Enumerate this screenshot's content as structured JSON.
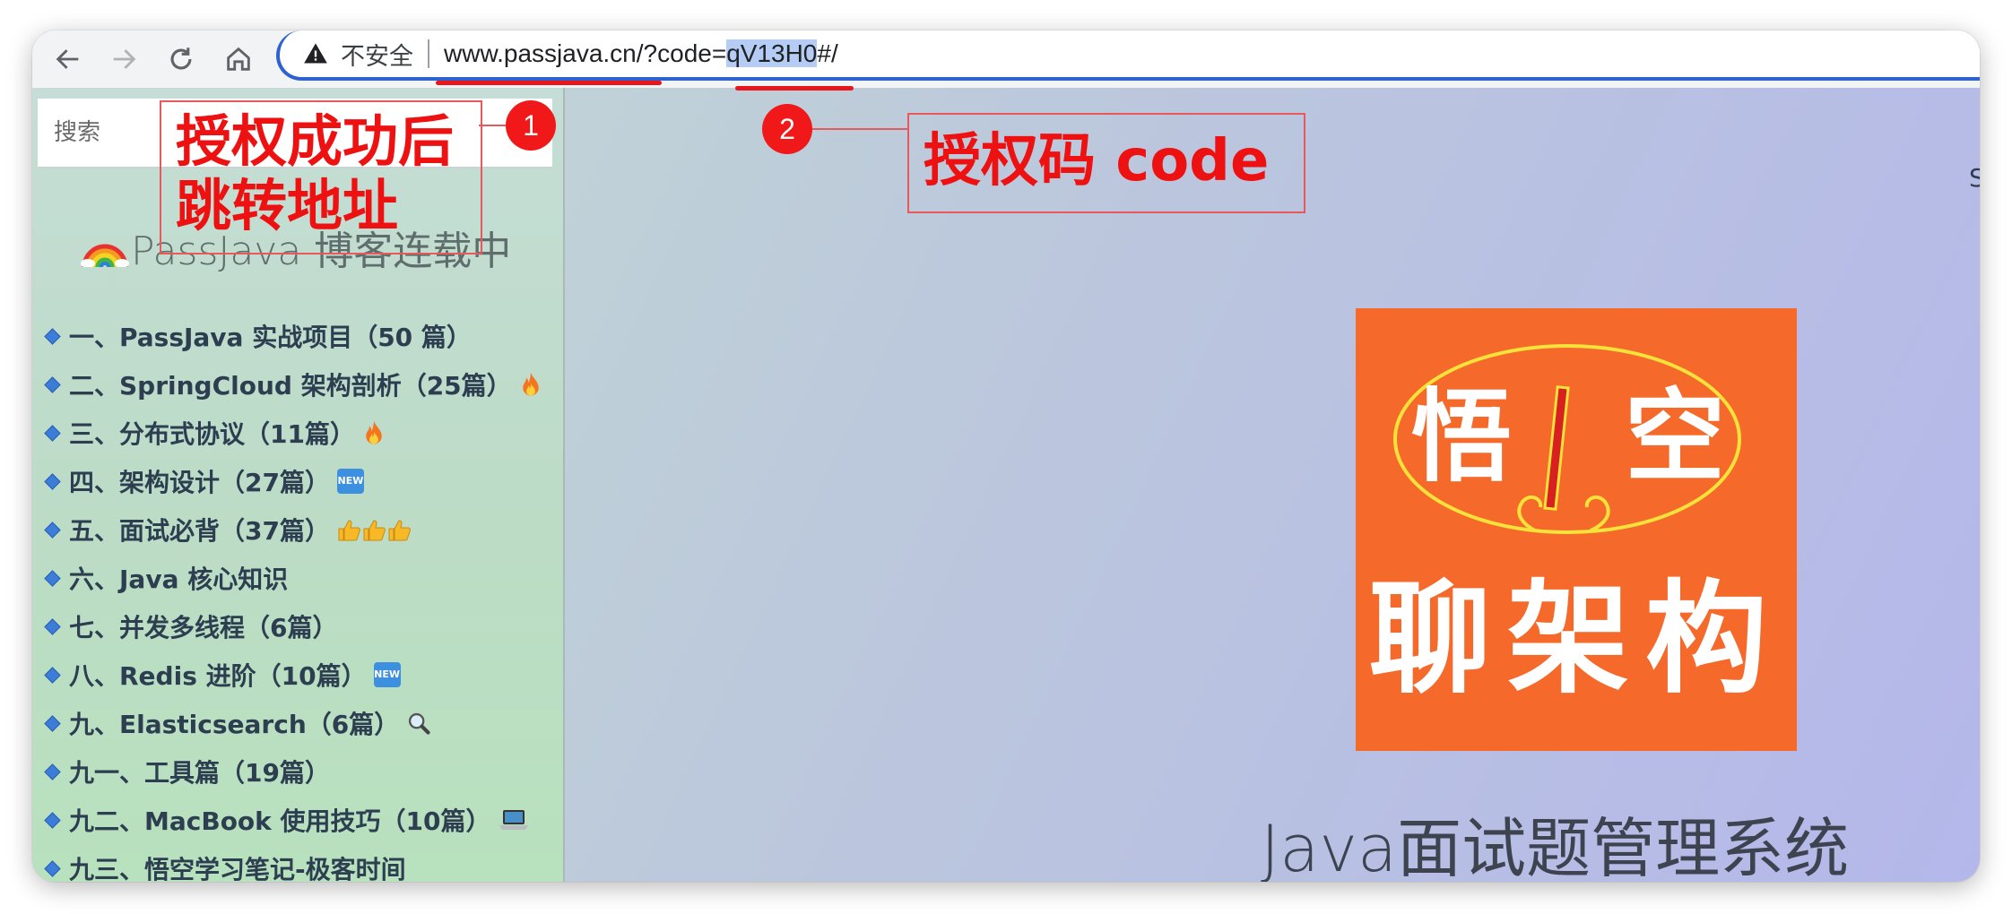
{
  "browser": {
    "security_label": "不安全",
    "url_host": "www.passjava.cn",
    "url_query_prefix": "/?code=",
    "url_code": "qV13H0",
    "url_suffix": "#/"
  },
  "sidebar": {
    "search_placeholder": "搜索",
    "title": "PassJava 博客连载中",
    "items": [
      {
        "label": "一、PassJava 实战项目（50 篇）",
        "badge": ""
      },
      {
        "label": "二、SpringCloud 架构剖析（25篇）",
        "badge": "fire"
      },
      {
        "label": "三、分布式协议（11篇）",
        "badge": "fire"
      },
      {
        "label": "四、架构设计（27篇）",
        "badge": "new"
      },
      {
        "label": "五、面试必背（37篇）",
        "badge": "thumbs"
      },
      {
        "label": "六、Java 核心知识",
        "badge": ""
      },
      {
        "label": "七、并发多线程（6篇）",
        "badge": ""
      },
      {
        "label": "八、Redis 进阶（10篇）",
        "badge": "new"
      },
      {
        "label": "九、Elasticsearch（6篇）",
        "badge": "magnifier"
      },
      {
        "label": "九一、工具篇（19篇）",
        "badge": ""
      },
      {
        "label": "九二、MacBook 使用技巧（10篇）",
        "badge": "laptop"
      },
      {
        "label": "九三、悟空学习笔记-极客时间",
        "badge": ""
      }
    ]
  },
  "main": {
    "edge_text": "S",
    "logo_top_text": "悟空",
    "logo_top_left": "悟",
    "logo_top_right": "空",
    "logo_bottom_text": "聊架构",
    "title": "Java面试题管理系统"
  },
  "annotations": {
    "note1_number": "1",
    "note1_line1": "授权成功后",
    "note1_line2": "跳转地址",
    "note2_number": "2",
    "note2_text": "授权码 code"
  },
  "colors": {
    "annotation_red": "#ee1111",
    "logo_orange": "#f5692a",
    "omnibox_border": "#2f62d1",
    "code_highlight": "#b5cdf5"
  }
}
